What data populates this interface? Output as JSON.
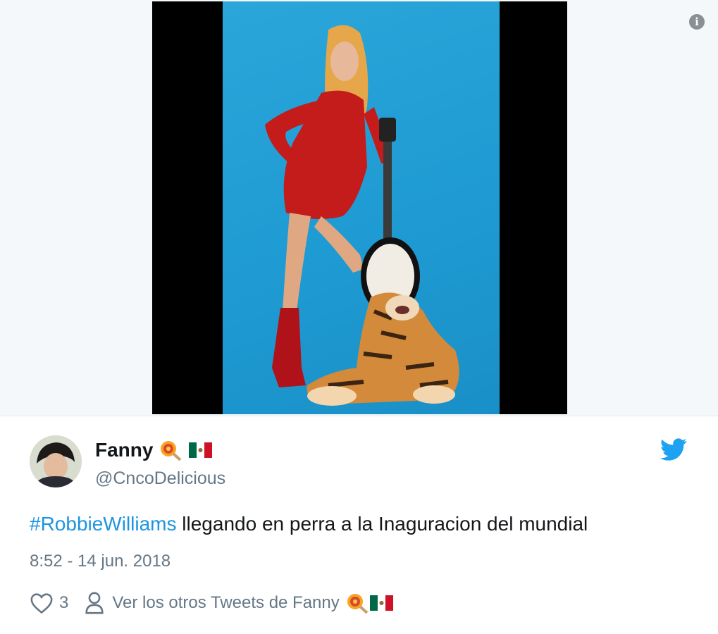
{
  "tweet": {
    "display_name": "Fanny",
    "handle": "@CncoDelicious",
    "hashtag": "#RobbieWilliams",
    "text": " llegando en perra a la Inaguracion del mundial",
    "timestamp": "8:52 - 14 jun. 2018",
    "like_count": "3",
    "more_tweets_label": "Ver los otros Tweets de Fanny"
  },
  "icons": {
    "info": "info-icon",
    "lollipop": "lollipop-emoji",
    "flag": "mexico-flag-emoji",
    "bird": "twitter-bird-icon",
    "heart": "heart-icon",
    "person": "person-icon"
  },
  "colors": {
    "link": "#1b95e0",
    "muted": "#657786",
    "text": "#14171a",
    "twitter_blue": "#1da1f2",
    "photo_bg": "#1f9bd3"
  },
  "info_glyph": "i"
}
